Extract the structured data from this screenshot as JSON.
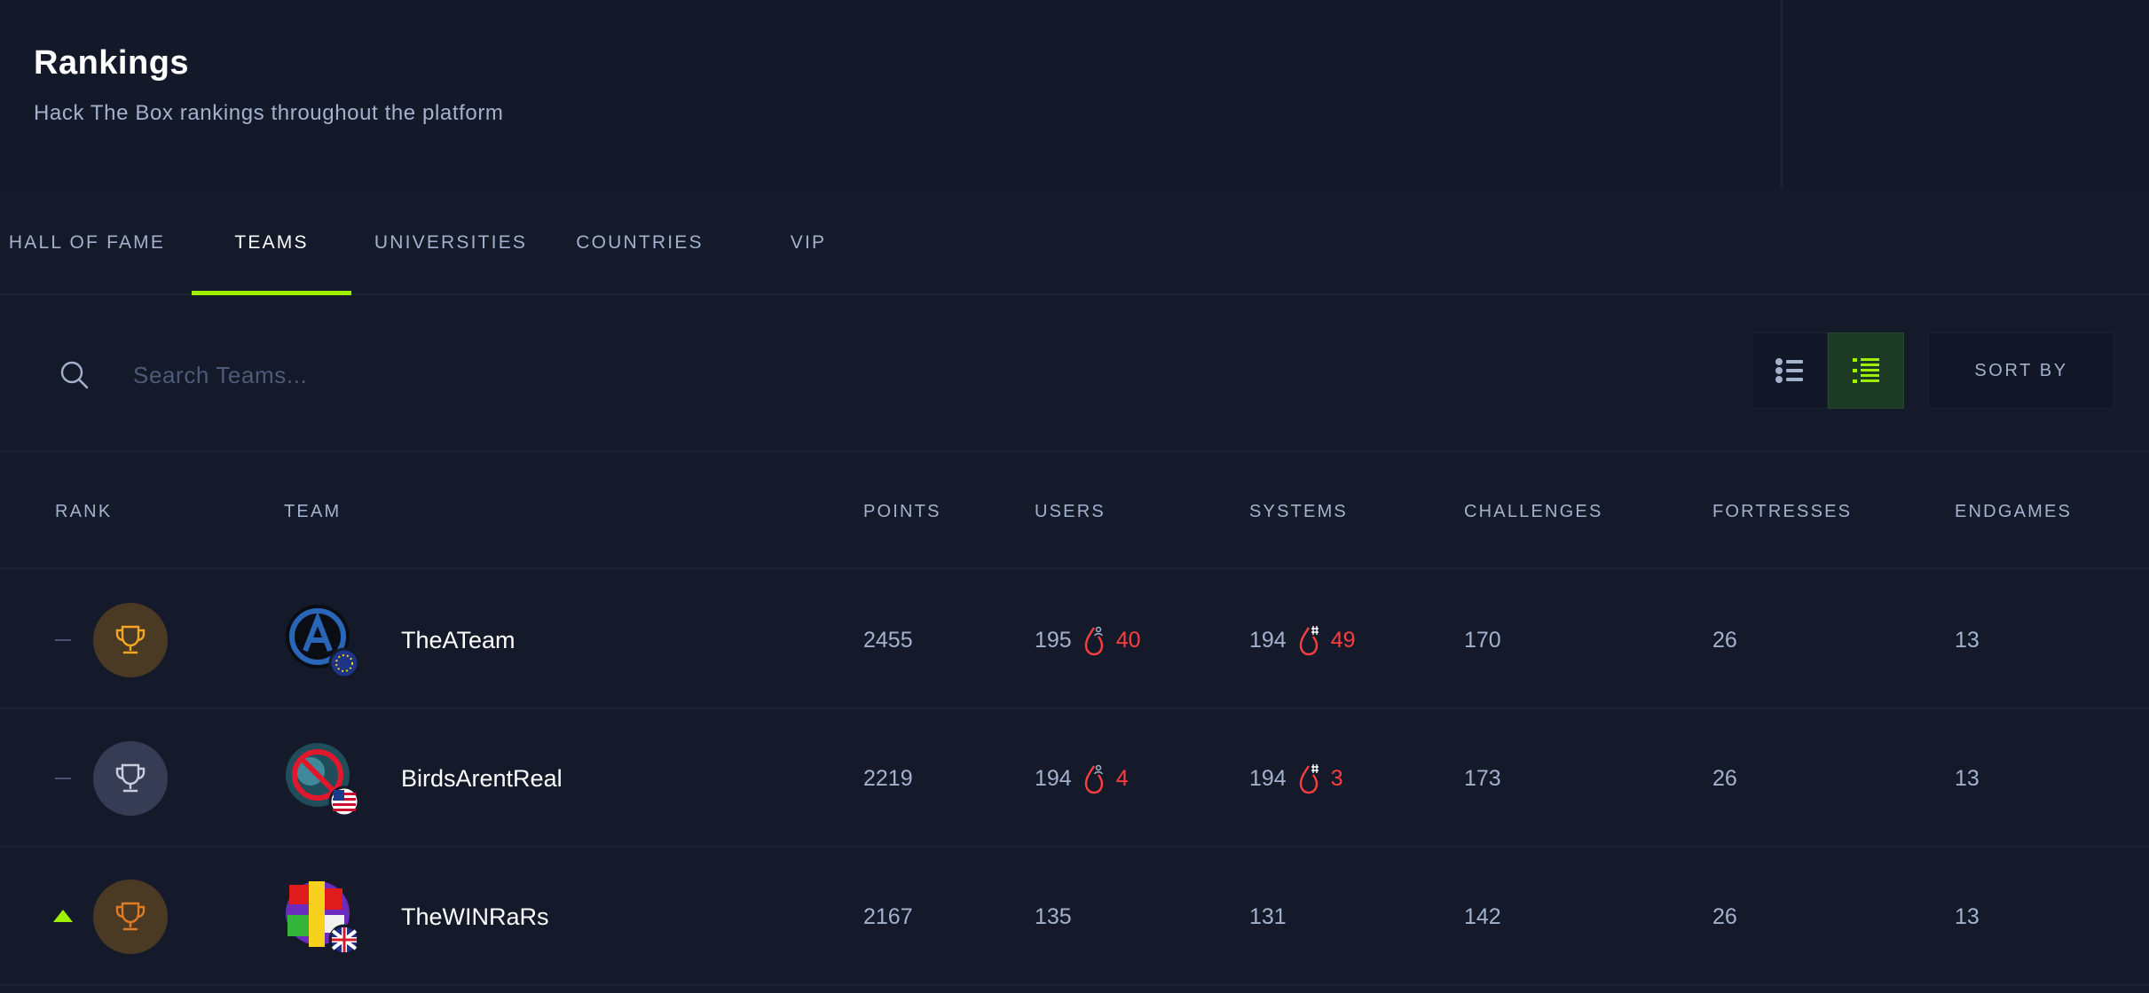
{
  "page": {
    "title": "Rankings",
    "subtitle": "Hack The Box rankings throughout the platform"
  },
  "tabs": [
    {
      "label": "HALL OF FAME",
      "active": false
    },
    {
      "label": "TEAMS",
      "active": true
    },
    {
      "label": "UNIVERSITIES",
      "active": false
    },
    {
      "label": "COUNTRIES",
      "active": false
    },
    {
      "label": "VIP",
      "active": false
    }
  ],
  "toolbar": {
    "search_placeholder": "Search Teams...",
    "search_value": "",
    "sort_label": "SORT BY",
    "active_view": "detailed-list"
  },
  "table": {
    "headers": {
      "rank": "RANK",
      "team": "TEAM",
      "points": "POINTS",
      "users": "USERS",
      "systems": "SYSTEMS",
      "challenges": "CHALLENGES",
      "fortresses": "FORTRESSES",
      "endgames": "ENDGAMES"
    },
    "rows": [
      {
        "rank_change": "none",
        "trophy": "gold",
        "name": "TheATeam",
        "flag": "eu",
        "points": "2455",
        "users": "195",
        "user_bloods": "40",
        "systems": "194",
        "system_bloods": "49",
        "challenges": "170",
        "fortresses": "26",
        "endgames": "13"
      },
      {
        "rank_change": "none",
        "trophy": "silver",
        "name": "BirdsArentReal",
        "flag": "us",
        "points": "2219",
        "users": "194",
        "user_bloods": "4",
        "systems": "194",
        "system_bloods": "3",
        "challenges": "173",
        "fortresses": "26",
        "endgames": "13"
      },
      {
        "rank_change": "up",
        "trophy": "bronze",
        "name": "TheWINRaRs",
        "flag": "gb",
        "points": "2167",
        "users": "135",
        "systems": "131",
        "challenges": "142",
        "fortresses": "26",
        "endgames": "13"
      }
    ]
  },
  "colors": {
    "background": "#141a2a",
    "accent_green": "#9fef00",
    "blood_red": "#ff3e3e",
    "muted_text": "#a4b1cd",
    "gold_trophy": "#f5a623",
    "silver_trophy": "#c8cede"
  },
  "icons": {
    "search": "search-icon",
    "list_view": "list-view-icon",
    "detailed_list_view": "detailed-list-view-icon",
    "trophy": "trophy-icon",
    "user_blood": "user-blood-icon",
    "system_blood": "system-blood-icon"
  }
}
